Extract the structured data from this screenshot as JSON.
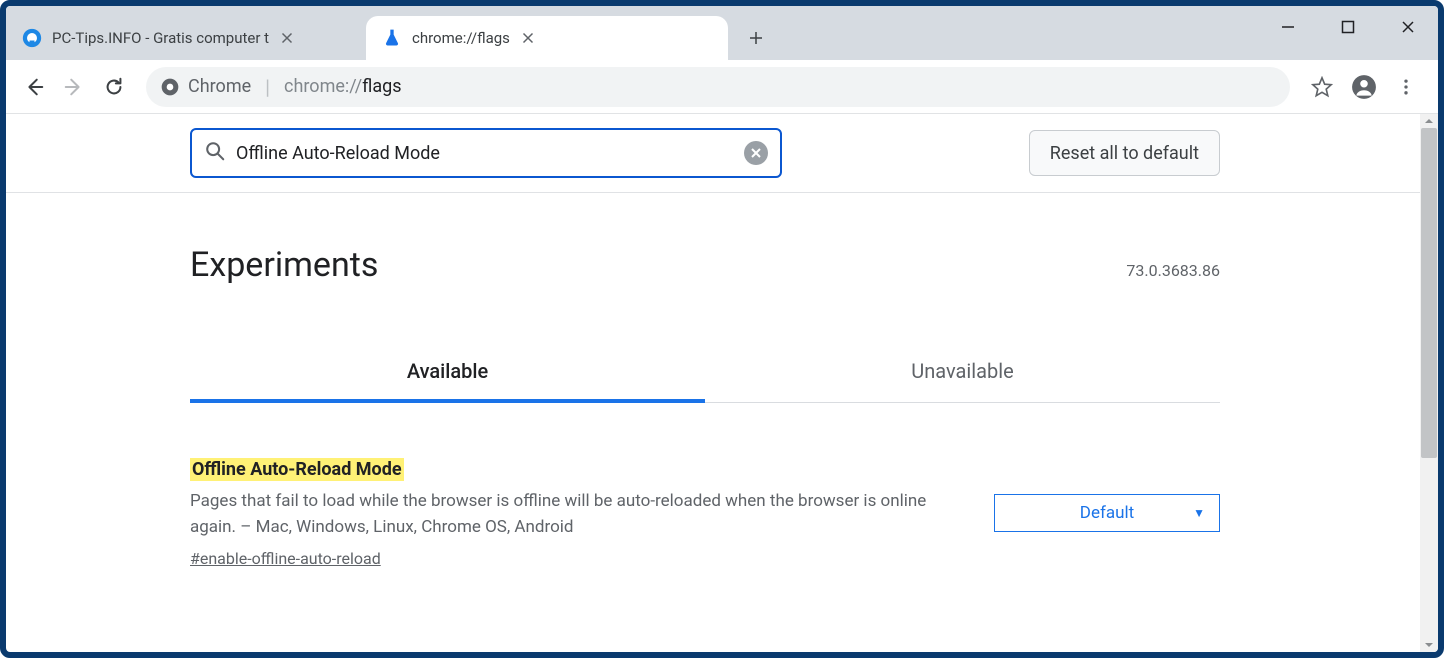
{
  "tabs": [
    {
      "title": "PC-Tips.INFO - Gratis computer t"
    },
    {
      "title": "chrome://flags"
    }
  ],
  "omnibox": {
    "chip": "Chrome",
    "url_prefix": "chrome://",
    "url_path": "flags"
  },
  "flags": {
    "search_value": "Offline Auto-Reload Mode",
    "reset_label": "Reset all to default",
    "headline": "Experiments",
    "version": "73.0.3683.86",
    "tab_available": "Available",
    "tab_unavailable": "Unavailable",
    "experiment": {
      "title": "Offline Auto-Reload Mode",
      "description": "Pages that fail to load while the browser is offline will be auto-reloaded when the browser is online again. – Mac, Windows, Linux, Chrome OS, Android",
      "anchor": "#enable-offline-auto-reload",
      "select_value": "Default"
    }
  }
}
